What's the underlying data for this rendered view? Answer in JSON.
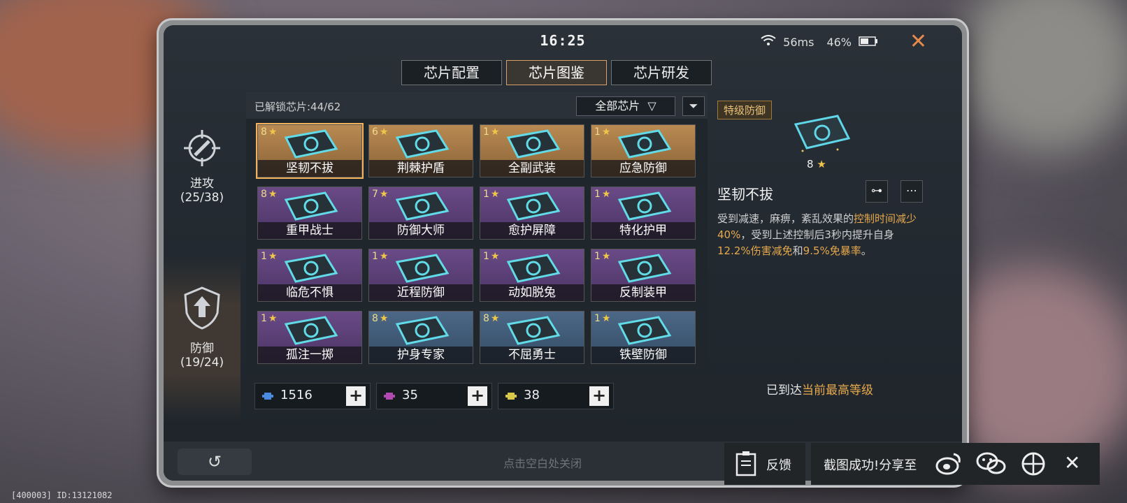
{
  "status": {
    "time": "16:25",
    "ping": "56ms",
    "battery": "46%"
  },
  "tabs": [
    {
      "label": "芯片配置",
      "active": false
    },
    {
      "label": "芯片图鉴",
      "active": true
    },
    {
      "label": "芯片研发",
      "active": false
    }
  ],
  "sidebar": {
    "items": [
      {
        "label": "进攻",
        "count": "(25/38)",
        "icon": "crosshair-missile-icon"
      },
      {
        "label": "防御",
        "count": "(19/24)",
        "icon": "shield-arrow-icon",
        "active": true
      }
    ]
  },
  "grid": {
    "unlocked": "已解锁芯片:44/62",
    "filter": "全部芯片",
    "cards": [
      {
        "stars": "8",
        "name": "坚韧不拔",
        "rarity": "gold",
        "selected": true
      },
      {
        "stars": "6",
        "name": "荆棘护盾",
        "rarity": "gold"
      },
      {
        "stars": "1",
        "name": "全副武装",
        "rarity": "gold"
      },
      {
        "stars": "1",
        "name": "应急防御",
        "rarity": "gold"
      },
      {
        "stars": "8",
        "name": "重甲战士",
        "rarity": "purple"
      },
      {
        "stars": "7",
        "name": "防御大师",
        "rarity": "purple"
      },
      {
        "stars": "1",
        "name": "愈护屏障",
        "rarity": "purple"
      },
      {
        "stars": "1",
        "name": "特化护甲",
        "rarity": "purple"
      },
      {
        "stars": "1",
        "name": "临危不惧",
        "rarity": "purple"
      },
      {
        "stars": "1",
        "name": "近程防御",
        "rarity": "purple"
      },
      {
        "stars": "1",
        "name": "动如脱兔",
        "rarity": "purple"
      },
      {
        "stars": "1",
        "name": "反制装甲",
        "rarity": "purple"
      },
      {
        "stars": "1",
        "name": "孤注一掷",
        "rarity": "purple"
      },
      {
        "stars": "8",
        "name": "护身专家",
        "rarity": "blue"
      },
      {
        "stars": "8",
        "name": "不屈勇士",
        "rarity": "blue"
      },
      {
        "stars": "1",
        "name": "铁壁防御",
        "rarity": "blue"
      }
    ]
  },
  "resources": [
    {
      "value": "1516",
      "color": "#4a8be0"
    },
    {
      "value": "35",
      "color": "#b04ab0"
    },
    {
      "value": "38",
      "color": "#d8c84a"
    }
  ],
  "details": {
    "tier": "特级防御",
    "stars": "8",
    "name": "坚韧不拔",
    "desc_1": "受到减速，麻痹，紊乱效果的",
    "desc_hl_1": "控制时间减少40%",
    "desc_2": "，受到上述控制后3秒内提升自身",
    "desc_hl_2": "12.2%伤害减免",
    "desc_3": "和",
    "desc_hl_3": "9.5%免暴率",
    "desc_4": "。",
    "max_prefix": "已到达",
    "max_hl": "当前最高等级"
  },
  "bottom": {
    "tap_close": "点击空白处关闭"
  },
  "toast": {
    "feedback": "反馈",
    "share_text": "截图成功!分享至"
  },
  "debug": "[400003] ID:13121082",
  "colors": {
    "accent": "#e6a94d",
    "tab_active_border": "#d9a06a"
  }
}
